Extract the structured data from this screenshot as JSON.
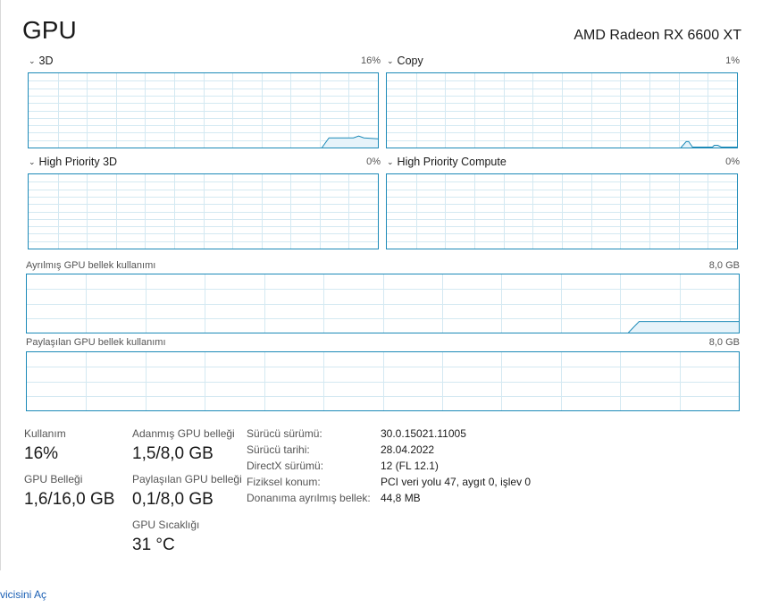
{
  "header": {
    "title": "GPU",
    "gpu_name": "AMD Radeon RX 6600 XT"
  },
  "engines": [
    {
      "label": "3D",
      "percent": "16%",
      "level": 0.13
    },
    {
      "label": "Copy",
      "percent": "1%",
      "level": 0.1
    },
    {
      "label": "High Priority 3D",
      "percent": "0%",
      "level": 0
    },
    {
      "label": "High Priority Compute",
      "percent": "0%",
      "level": 0
    }
  ],
  "memory": {
    "dedicated_label": "Ayrılmış GPU bellek kullanımı",
    "dedicated_max": "8,0 GB",
    "dedicated_level": 0.19,
    "shared_label": "Paylaşılan GPU bellek kullanımı",
    "shared_max": "8,0 GB",
    "shared_level": 0
  },
  "stats": {
    "utilization_label": "Kullanım",
    "utilization_value": "16%",
    "gpu_memory_label": "GPU Belleği",
    "gpu_memory_value": "1,6/16,0 GB",
    "dedicated_mem_label": "Adanmış GPU belleği",
    "dedicated_mem_value": "1,5/8,0 GB",
    "shared_mem_label": "Paylaşılan GPU belleği",
    "shared_mem_value": "0,1/8,0 GB",
    "temp_label": "GPU Sıcaklığı",
    "temp_value": "31 °C"
  },
  "info": {
    "driver_version_label": "Sürücü sürümü:",
    "driver_version": "30.0.15021.11005",
    "driver_date_label": "Sürücü tarihi:",
    "driver_date": "28.04.2022",
    "directx_label": "DirectX sürümü:",
    "directx": "12 (FL 12.1)",
    "location_label": "Fiziksel konum:",
    "location": "PCI veri yolu 47, aygıt 0, işlev 0",
    "reserved_label": "Donanıma ayrılmış bellek:",
    "reserved": "44,8 MB"
  },
  "footer": {
    "open_link": "vicisini Aç"
  },
  "colors": {
    "accent": "#1c8ab8",
    "grid": "#d4e9f2",
    "fill": "#e6f3fa"
  }
}
